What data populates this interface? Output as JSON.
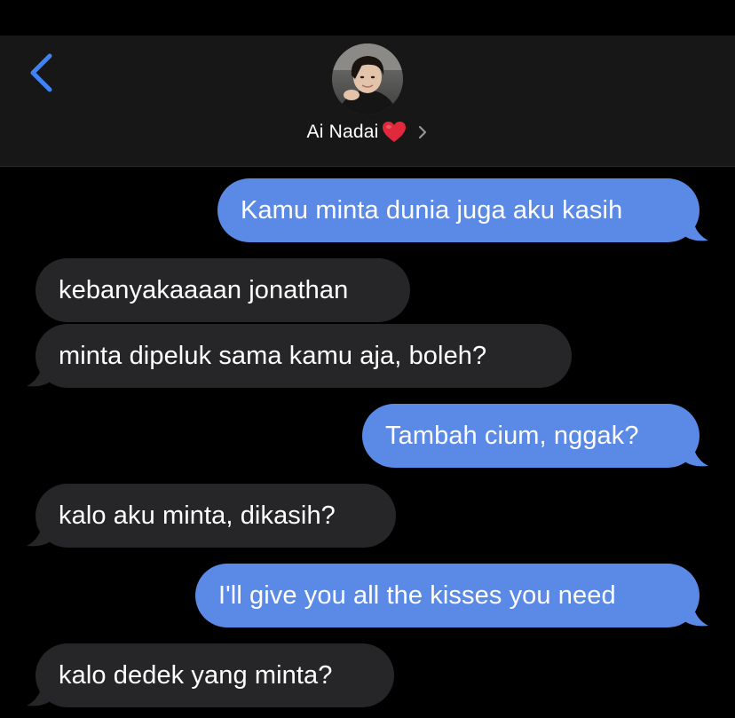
{
  "colors": {
    "background": "#000000",
    "header_bg": "#171717",
    "outgoing_bubble": "#5b8ae6",
    "incoming_bubble": "#262628",
    "accent": "#3f84f6",
    "heart": "#e0293c"
  },
  "header": {
    "back_icon": "chevron-left-icon",
    "contact_name": "Ai Nadai",
    "name_emoji_icon": "red-heart-icon",
    "details_icon": "chevron-right-icon"
  },
  "messages": [
    {
      "direction": "outgoing",
      "text": "Kamu minta dunia juga aku kasih"
    },
    {
      "direction": "incoming",
      "text": "kebanyakaaaan jonathan"
    },
    {
      "direction": "incoming",
      "text": "minta dipeluk sama kamu aja, boleh?"
    },
    {
      "direction": "outgoing",
      "text": "Tambah cium, nggak?"
    },
    {
      "direction": "incoming",
      "text": "kalo aku minta, dikasih?"
    },
    {
      "direction": "outgoing",
      "text": "I'll give you all the kisses you need"
    },
    {
      "direction": "incoming",
      "text": "kalo dedek yang minta?"
    }
  ]
}
